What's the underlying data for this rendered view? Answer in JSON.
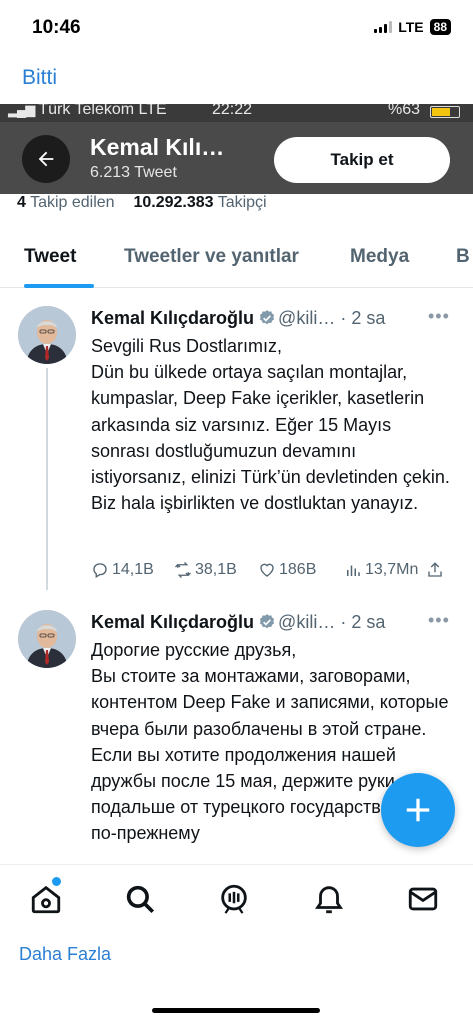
{
  "ios_status": {
    "time": "10:46",
    "network": "LTE",
    "battery": "88"
  },
  "done_label": "Bitti",
  "inner_status": {
    "carrier": "Türk Telekom  LTE",
    "time": "22:22",
    "battery": "%63"
  },
  "profile": {
    "name": "Kemal Kılı…",
    "tweet_count": "6.213 Tweet",
    "follow_button": "Takip et",
    "following_count": "4",
    "following_label": "Takip edilen",
    "followers_count": "10.292.383",
    "followers_label": "Takipçi"
  },
  "tabs": [
    {
      "label": "Tweet",
      "active": true
    },
    {
      "label": "Tweetler ve yanıtlar",
      "active": false
    },
    {
      "label": "Medya",
      "active": false
    },
    {
      "label": "B",
      "active": false
    }
  ],
  "tweets": [
    {
      "author": "Kemal Kılıçdaroğlu",
      "handle": "@kili… · 2 sa",
      "more": "•••",
      "text": "Sevgili Rus Dostlarımız,\nDün bu ülkede ortaya saçılan montajlar, kumpaslar, Deep Fake içerikler, kasetlerin arkasında siz varsınız. Eğer 15 Mayıs sonrası dostluğumuzun devamını istiyorsanız, elinizi Türk’ün devletinden çekin. Biz hala işbirlikten ve dostluktan yanayız.",
      "replies": "14,1B",
      "retweets": "38,1B",
      "likes": "186B",
      "views": "13,7Mn"
    },
    {
      "author": "Kemal Kılıçdaroğlu",
      "handle": "@kili… · 2 sa",
      "more": "•••",
      "text": "Дорогие русские друзья,\nВы стоите за монтажами, заговорами, контентом Deep Fake и записями, которые вчера были разоблачены в этой стране. Если вы хотите продолжения нашей дружбы после 15 мая, держите руки подальше от турецкого государства. Мы по-прежнему"
    }
  ],
  "bottom_more": "Daha Fazla",
  "colors": {
    "accent": "#1d9bf0",
    "link": "#2a7fd4",
    "header_bg": "#4a4a4a"
  },
  "icons": [
    "back-arrow-icon",
    "verified-badge-icon",
    "reply-icon",
    "retweet-icon",
    "like-icon",
    "views-icon",
    "share-icon",
    "compose-icon",
    "home-icon",
    "search-icon",
    "spaces-icon",
    "notifications-icon",
    "messages-icon"
  ]
}
